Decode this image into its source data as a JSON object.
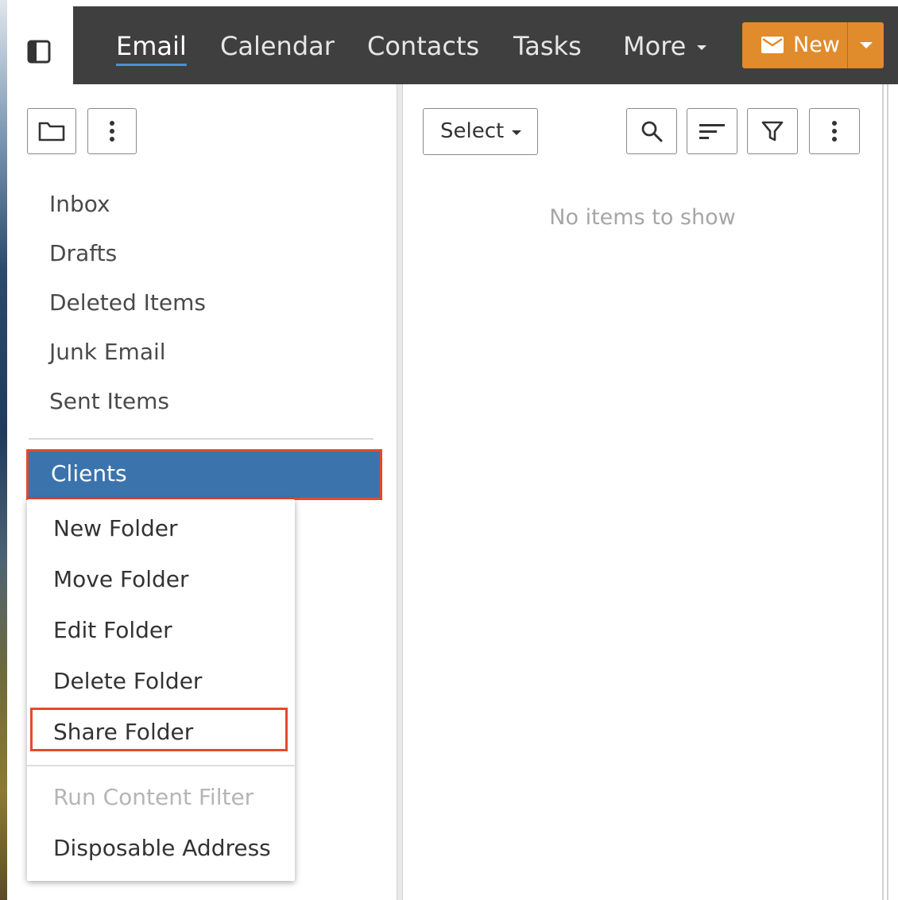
{
  "nav": {
    "tabs": [
      {
        "label": "Email",
        "active": true
      },
      {
        "label": "Calendar"
      },
      {
        "label": "Contacts"
      },
      {
        "label": "Tasks"
      },
      {
        "label": "More"
      }
    ],
    "new_button": "New"
  },
  "folders": {
    "items": [
      "Inbox",
      "Drafts",
      "Deleted Items",
      "Junk Email",
      "Sent Items"
    ],
    "selected": "Clients"
  },
  "context_menu": {
    "items": [
      "New Folder",
      "Move Folder",
      "Edit Folder",
      "Delete Folder",
      "Share Folder"
    ],
    "disabled_items": [
      "Run Content Filter"
    ],
    "extra_items": [
      "Disposable Address"
    ]
  },
  "main": {
    "select_label": "Select",
    "empty_message": "No items to show"
  },
  "colors": {
    "navbar": "#3f3f3f",
    "accent_orange": "#e08b2c",
    "selected_blue": "#3b74ad",
    "highlight_red": "#e04b2e",
    "active_underline": "#4a90d9"
  }
}
